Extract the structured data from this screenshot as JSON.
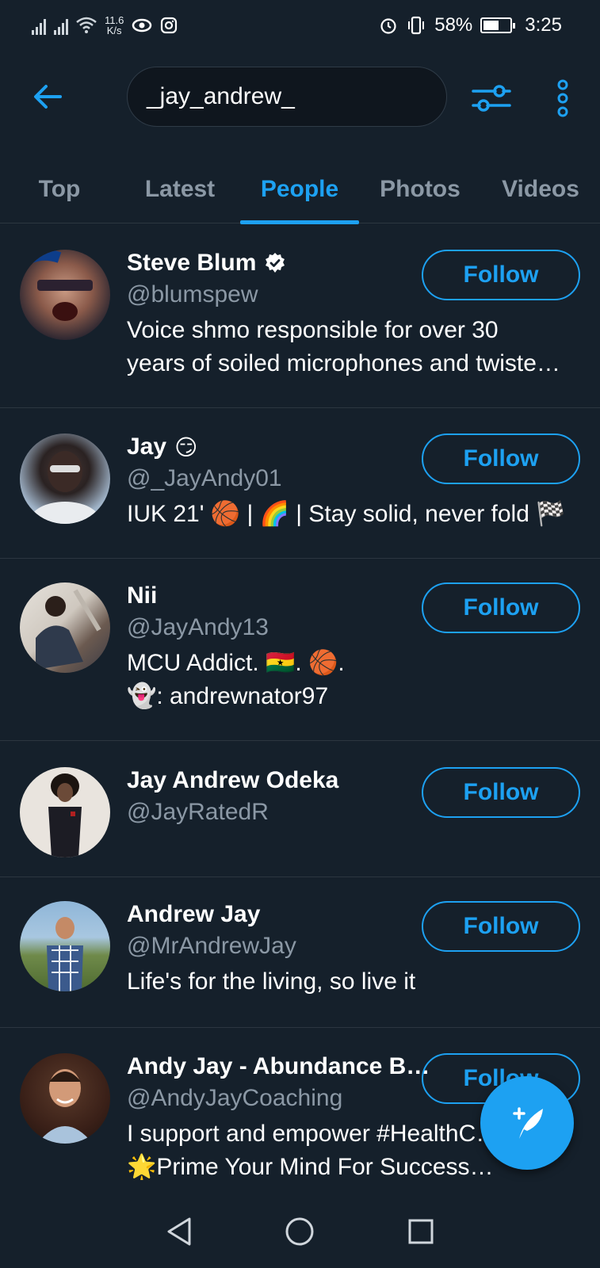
{
  "status_bar": {
    "net_speed_value": "11.6",
    "net_speed_unit": "K/s",
    "battery": "58%",
    "time": "3:25"
  },
  "header": {
    "search_query": "_jay_andrew_"
  },
  "tabs": [
    {
      "label": "Top"
    },
    {
      "label": "Latest"
    },
    {
      "label": "People",
      "active": true
    },
    {
      "label": "Photos"
    },
    {
      "label": "Videos"
    }
  ],
  "users": [
    {
      "name": "Steve Blum",
      "verified": true,
      "handle": "@blumspew",
      "bio_lines": [
        "Voice shmo responsible for over 30",
        "years of soiled microphones and twiste…"
      ],
      "follow_label": "Follow"
    },
    {
      "name": "Jay",
      "name_emoji": "😏",
      "handle": "@_JayAndy01",
      "bio_lines": [
        "IUK 21' 🏀 | 🌈 | Stay solid, never fold 🏁"
      ],
      "follow_label": "Follow"
    },
    {
      "name": "Nii",
      "handle": "@JayAndy13",
      "bio_lines": [
        "MCU Addict. 🇬🇭. 🏀.",
        "👻: andrewnator97"
      ],
      "follow_label": "Follow"
    },
    {
      "name": "Jay Andrew Odeka",
      "handle": "@JayRatedR",
      "bio_lines": [],
      "follow_label": "Follow"
    },
    {
      "name": "Andrew Jay",
      "handle": "@MrAndrewJay",
      "bio_lines": [
        "Life's for the living, so live it"
      ],
      "follow_label": "Follow"
    },
    {
      "name": "Andy Jay - Abundance B…",
      "handle": "@AndyJayCoaching",
      "bio_lines": [
        "I support and empower #HealthC…s",
        "🌟Prime Your Mind For Success…"
      ],
      "follow_label": "Follow"
    }
  ],
  "colors": {
    "background": "#15202b",
    "accent": "#1da1f2",
    "secondary_text": "#8b98a5",
    "divider": "#2c3640"
  }
}
